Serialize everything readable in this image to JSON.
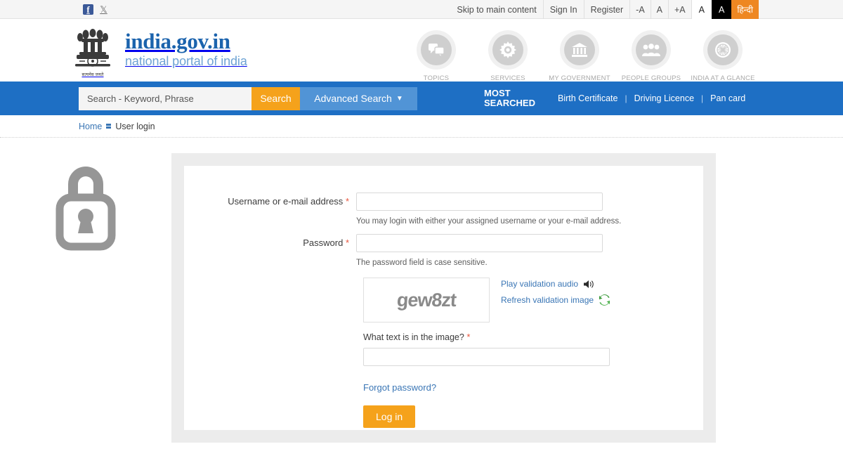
{
  "topbar": {
    "social": [
      {
        "name": "facebook-icon",
        "glyph": "f"
      },
      {
        "name": "x-icon",
        "glyph": "𝕏"
      }
    ],
    "skip_link": "Skip to main content",
    "sign_in": "Sign In",
    "register": "Register",
    "font_decrease": "-A",
    "font_normal": "A",
    "font_increase": "+A",
    "contrast_normal": "A",
    "contrast_invert": "A",
    "language_hindi": "हिन्दी",
    "colors": {
      "hindi_bg": "#ee8722",
      "invert_bg": "#000000"
    }
  },
  "brand": {
    "emblem_motto": "सत्यमेव जयते",
    "title": "india.gov.in",
    "subtitle": "national portal of india",
    "title_color": "#1b63ad",
    "subtitle_color": "#6ea3d4"
  },
  "topnav": [
    {
      "label": "TOPICS",
      "icon": "speech-bubbles-icon"
    },
    {
      "label": "SERVICES",
      "icon": "gear-icon"
    },
    {
      "label": "MY GOVERNMENT",
      "icon": "bank-building-icon"
    },
    {
      "label": "PEOPLE GROUPS",
      "icon": "people-group-icon"
    },
    {
      "label": "INDIA AT A GLANCE",
      "icon": "ashoka-chakra-icon"
    }
  ],
  "search": {
    "placeholder": "Search - Keyword, Phrase",
    "value": "",
    "button_label": "Search",
    "advanced_label": "Advanced Search",
    "advanced_caret": "▼",
    "button_color": "#f5a21b",
    "bar_color": "#1e6fc4"
  },
  "most_searched": {
    "label_line1": "MOST",
    "label_line2": "SEARCHED",
    "links": [
      "Birth Certificate",
      "Driving Licence",
      "Pan card"
    ],
    "separator": "|"
  },
  "breadcrumb": {
    "home": "Home",
    "current": "User login"
  },
  "side": {
    "lock_icon": "padlock-icon"
  },
  "form": {
    "username": {
      "label": "Username or e-mail address",
      "required_mark": "*",
      "value": "",
      "help": "You may login with either your assigned username or your e-mail address."
    },
    "password": {
      "label": "Password",
      "required_mark": "*",
      "value": "",
      "help": "The password field is case sensitive."
    },
    "captcha": {
      "image_text": "gew8zt",
      "play_audio_link": "Play validation audio",
      "refresh_link": "Refresh validation image",
      "question_label": "What text is in the image?",
      "required_mark": "*",
      "answer_value": ""
    },
    "forgot_password": "Forgot password?",
    "login_button": "Log in"
  }
}
